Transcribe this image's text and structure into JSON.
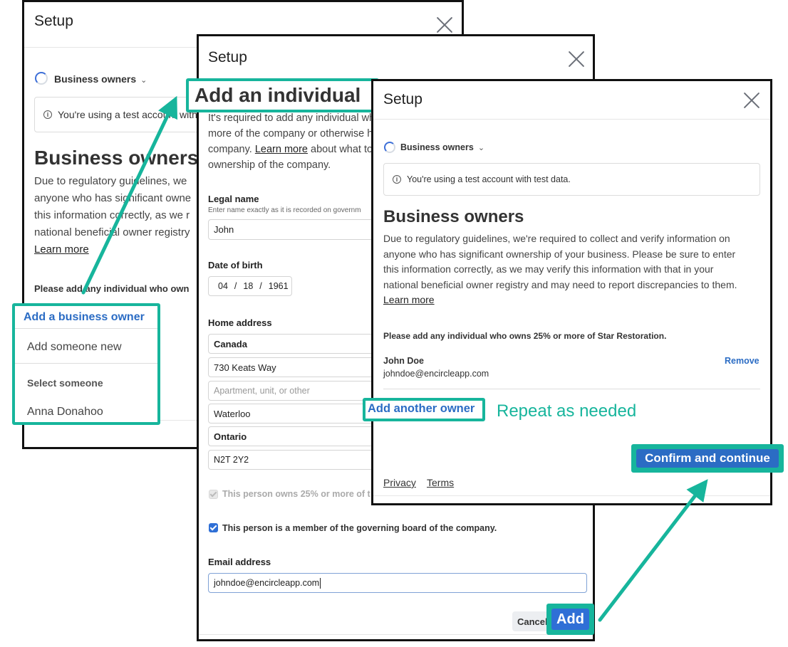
{
  "dialog1": {
    "title": "Setup",
    "breadcrumb": "Business owners",
    "notice": "You're using a test account with",
    "heading": "Business owners",
    "paragraph_lines": [
      "Due to regulatory guidelines, we",
      "anyone who has significant owne",
      "this information correctly, as we r",
      "national beneficial owner registry"
    ],
    "learn_more": "Learn more",
    "prompt": "Please add any individual who own",
    "dropdown": {
      "header": "Add a business owner",
      "add_new": "Add someone new",
      "select_label": "Select someone",
      "option_1": "Anna Donahoo"
    }
  },
  "dialog2": {
    "title": "Setup",
    "heading": "Add an individual",
    "intro_line1": "It's required to add any individual wh",
    "intro_line2": "more of the company or otherwise h",
    "intro_line3_pre": "company.",
    "intro_learn_more": "Learn more",
    "intro_line3_post": "about what to",
    "intro_line4": "ownership of the company.",
    "legal_name_label": "Legal name",
    "legal_name_hint": "Enter name exactly as it is recorded on governm",
    "legal_name_value": "John",
    "dob_label": "Date of birth",
    "dob_month": "04",
    "dob_day": "18",
    "dob_year": "1961",
    "dob_sep": "/",
    "home_address_label": "Home address",
    "country": "Canada",
    "street": "730 Keats Way",
    "apt_placeholder": "Apartment, unit, or other",
    "city": "Waterloo",
    "province": "Ontario",
    "postal": "N2T 2Y2",
    "owns_checkbox_label": "This person owns 25% or more of t",
    "board_checkbox_label": "This person is a member of the governing board of the company.",
    "email_label": "Email address",
    "email_value": "johndoe@encircleapp.com",
    "cancel_label": "Cancel",
    "add_label": "Add"
  },
  "dialog3": {
    "title": "Setup",
    "breadcrumb": "Business owners",
    "notice": "You're using a test account with test data.",
    "heading": "Business owners",
    "paragraph_lines": [
      "Due to regulatory guidelines, we're required to collect and verify information on",
      "anyone who has significant ownership of your business. Please be sure to enter",
      "this information correctly, as we may verify this information with that in your",
      "national beneficial owner registry and may need to report discrepancies to them."
    ],
    "learn_more": "Learn more",
    "prompt": "Please add any individual who owns 25% or more of Star Restoration.",
    "owner_name": "John Doe",
    "owner_email": "johndoe@encircleapp.com",
    "remove_label": "Remove",
    "add_another_label": "Add another owner",
    "confirm_label": "Confirm and continue",
    "privacy_label": "Privacy",
    "terms_label": "Terms"
  },
  "callouts": {
    "repeat_text": "Repeat as needed"
  },
  "colors": {
    "teal": "#17b59c",
    "link_blue": "#2b6cc4",
    "checkbox_blue": "#2f6fd6"
  }
}
